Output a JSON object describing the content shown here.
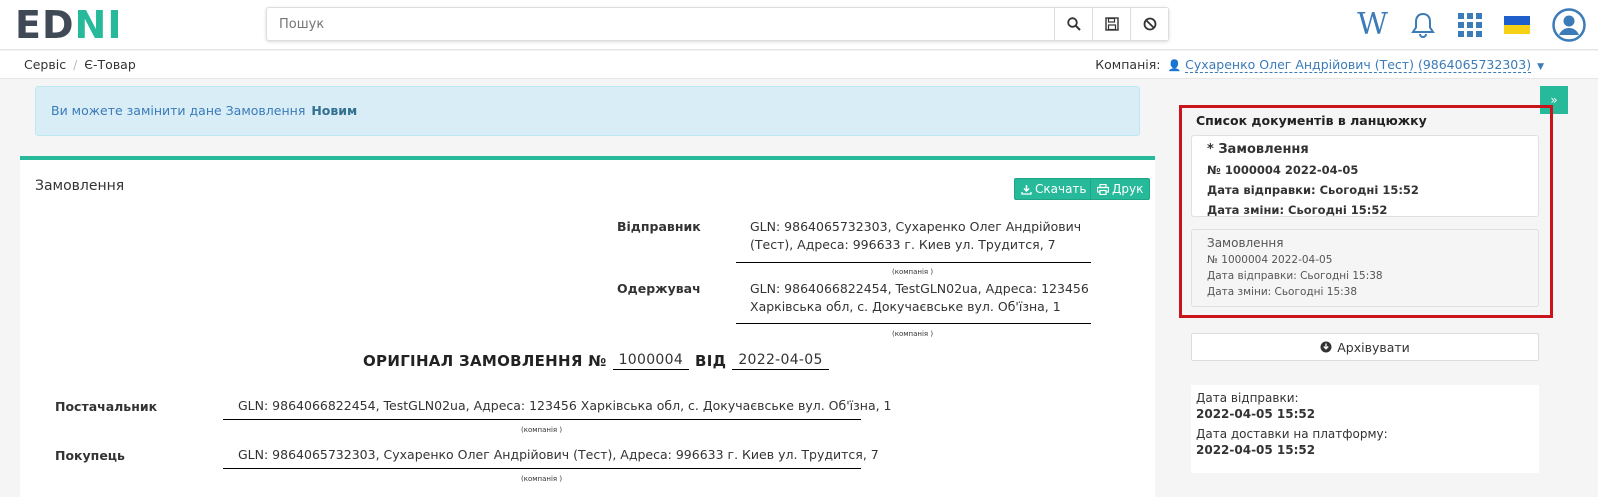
{
  "header": {
    "logo_left": "ED",
    "logo_right": "NI",
    "search_placeholder": "Пошук",
    "icons": [
      "search-icon",
      "save-icon",
      "ban-icon",
      "wiki-icon",
      "bell-icon",
      "apps-grid-icon",
      "ukraine-flag-icon",
      "user-avatar-icon"
    ],
    "wiki_label": "W"
  },
  "breadcrumb": [
    "Сервіс",
    "Є-Товар"
  ],
  "company": {
    "label": "Компанія:",
    "value": "Сухаренко Олег Андрійович (Тест) (9864065732303)"
  },
  "alert": {
    "text": "Ви можете замінити дане Замовлення",
    "link": "Новим"
  },
  "card": {
    "title": "Замовлення",
    "download_label": "Скачать",
    "print_label": "Друк"
  },
  "parties": {
    "sender_label": "Відправник",
    "sender_line1": "GLN: 9864065732303, Сухаренко Олег Андрійович",
    "sender_line2": "(Тест), Адреса: 996633 г. Киев ул. Трудится, 7",
    "receiver_label": "Одержувач",
    "receiver_line1": "GLN: 9864066822454, TestGLN02ua, Адреса: 123456",
    "receiver_line2": "Харківська обл, с. Докучаєвське вул. Об'їзна, 1",
    "company_caption": "(компанія )"
  },
  "doc_heading": {
    "prefix": "ОРИГІНАЛ ЗАМОВЛЕННЯ №",
    "number": "1000004",
    "from": "ВІД",
    "date": "2022-04-05"
  },
  "supplier": {
    "label": "Постачальник",
    "value": "GLN: 9864066822454, TestGLN02ua, Адреса: 123456 Харківська обл, с. Докучаєвське вул. Об'їзна, 1"
  },
  "buyer": {
    "label": "Покупець",
    "value": "GLN: 9864065732303, Сухаренко Олег Андрійович (Тест), Адреса: 996633 г. Киев ул. Трудится, 7"
  },
  "chain": {
    "title": "Список документів в ланцюжку",
    "documents": [
      {
        "title": "* Замовлення",
        "number": "№ 1000004 2022-04-05",
        "sent": "Дата відправки: Сьогодні 15:52",
        "changed": "Дата зміни: Сьогодні 15:52"
      },
      {
        "title": "Замовлення",
        "number": "№ 1000004 2022-04-05",
        "sent": "Дата відправки: Сьогодні 15:38",
        "changed": "Дата зміни: Сьогодні 15:38"
      }
    ]
  },
  "archive_label": "Архівувати",
  "dates": {
    "sent_label": "Дата відправки:",
    "sent_value": "2022-04-05 15:52",
    "delivered_label": "Дата доставки на платформу:",
    "delivered_value": "2022-04-05 15:52"
  },
  "colors": {
    "accent": "#26b99a",
    "link": "#3a7bb8",
    "highlight_frame": "#c9141c",
    "alert_bg": "#d9edf7"
  }
}
